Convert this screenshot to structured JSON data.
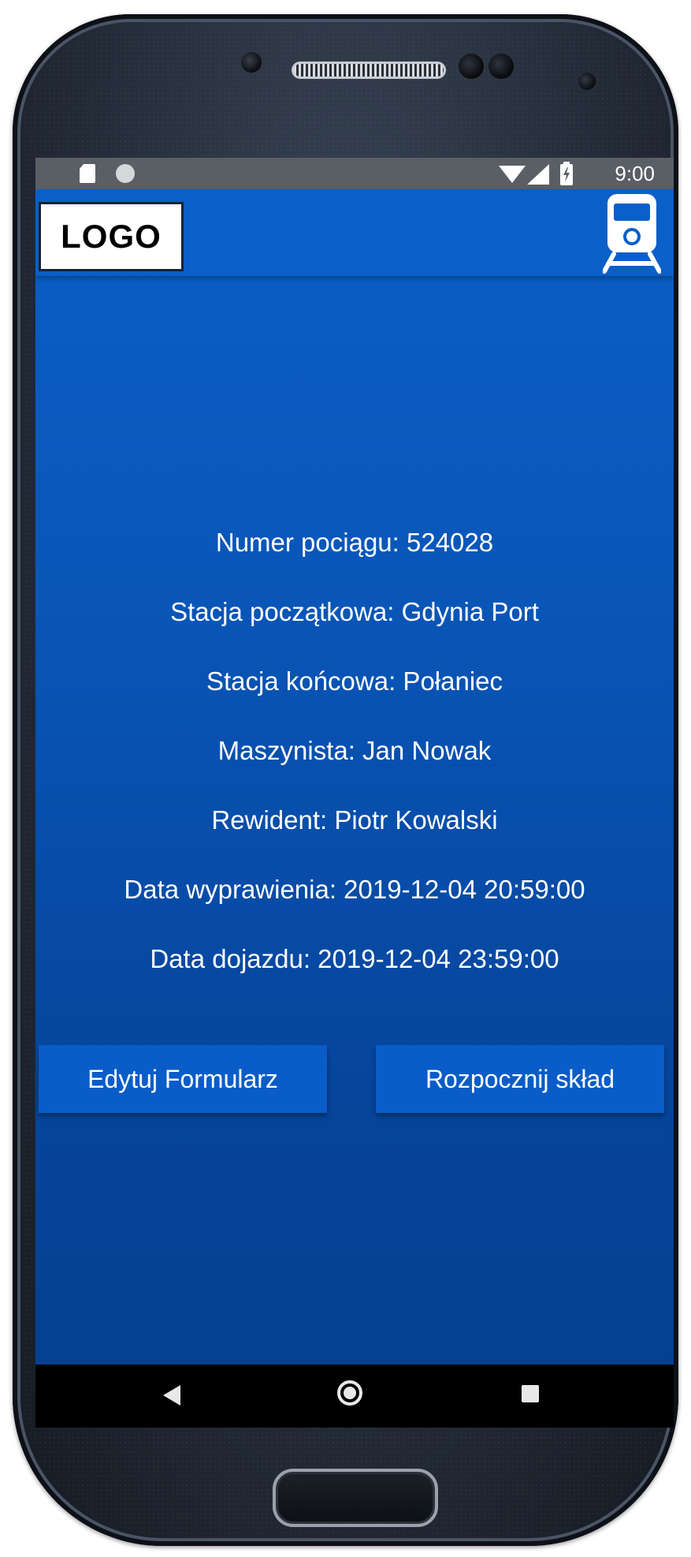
{
  "colors": {
    "screen_blue": "#0b5fc8",
    "button_blue": "#0a5cc8",
    "status_bar": "#5a5f66",
    "nav_bar": "#000000",
    "text": "#ffffff"
  },
  "status_bar": {
    "icons_left": [
      "sd-card-icon",
      "circle-icon"
    ],
    "icons_right": [
      "wifi-icon",
      "signal-icon",
      "battery-icon"
    ],
    "time": "9:00"
  },
  "app_bar": {
    "logo_text": "LOGO",
    "right_icon": "train-icon"
  },
  "train_info": [
    "Numer pociągu: 524028",
    "Stacja początkowa: Gdynia Port",
    "Stacja końcowa: Połaniec",
    "Maszynista: Jan Nowak",
    "Rewident: Piotr Kowalski",
    "Data wyprawienia: 2019-12-04 20:59:00",
    "Data dojazdu: 2019-12-04 23:59:00"
  ],
  "buttons": {
    "edit": "Edytuj Formularz",
    "start": "Rozpocznij skład"
  },
  "nav_bar": {
    "icons": [
      "back-icon",
      "home-icon",
      "recent-apps-icon"
    ]
  }
}
